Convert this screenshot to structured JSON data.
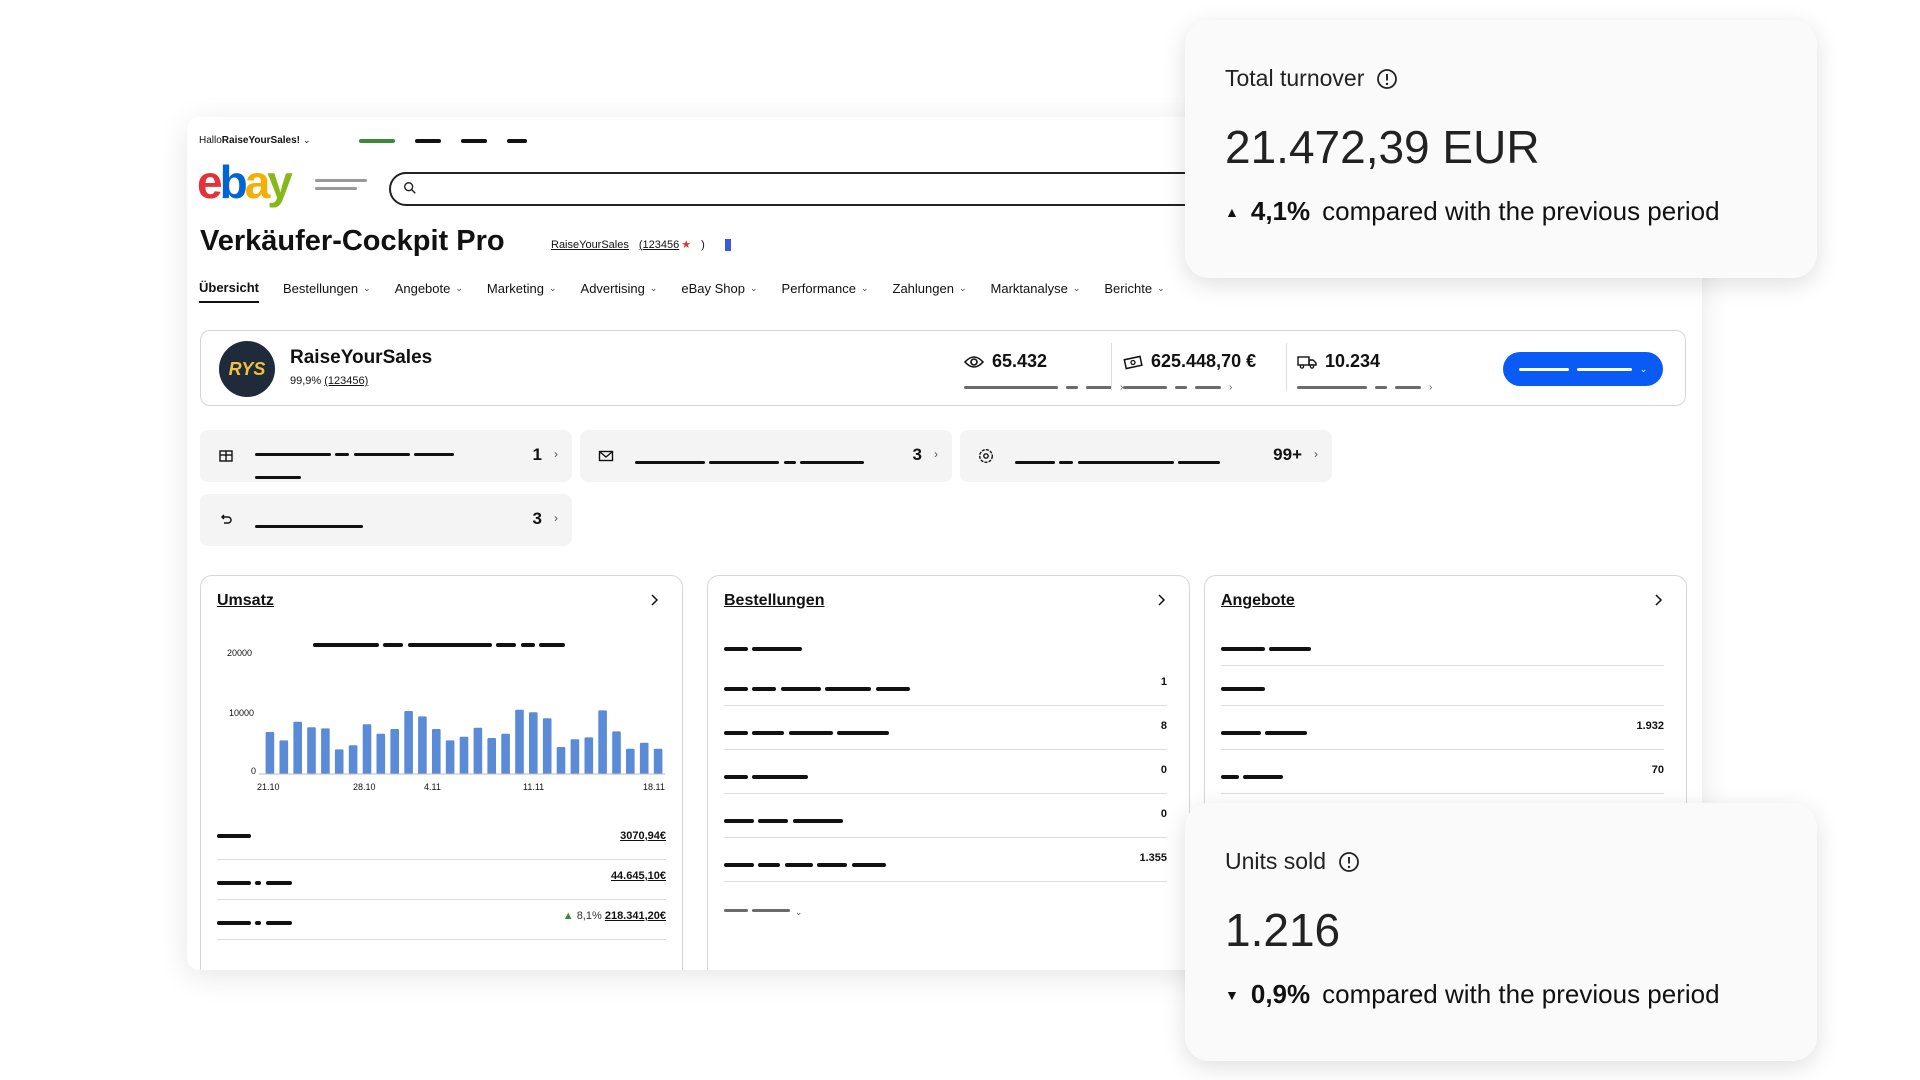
{
  "header": {
    "greeting_prefix": "Hallo ",
    "greeting_name": "RaiseYourSales!",
    "logo_letters": [
      "e",
      "b",
      "a",
      "y"
    ]
  },
  "page": {
    "title": "Verkäufer-Cockpit Pro",
    "seller_link": "RaiseYourSales",
    "seller_feedback": "(123456",
    "seller_feedback_close": ")"
  },
  "nav": {
    "tabs": [
      {
        "label": "Übersicht"
      },
      {
        "label": "Bestellungen"
      },
      {
        "label": "Angebote"
      },
      {
        "label": "Marketing"
      },
      {
        "label": "Advertising"
      },
      {
        "label": "eBay Shop"
      },
      {
        "label": "Performance"
      },
      {
        "label": "Zahlungen"
      },
      {
        "label": "Marktanalyse"
      },
      {
        "label": "Berichte"
      }
    ]
  },
  "seller": {
    "avatar_text": "RYS",
    "name": "RaiseYourSales",
    "rating": "99,9%",
    "rating_count": "(123456)",
    "views": "65.432",
    "sales": "625.448,70 €",
    "shipments": "10.234"
  },
  "tasks": [
    {
      "icon": "package-icon",
      "count": "1"
    },
    {
      "icon": "mail-icon",
      "count": "3"
    },
    {
      "icon": "settings-badge-icon",
      "count": "99+"
    },
    {
      "icon": "return-icon",
      "count": "3"
    }
  ],
  "umsatz": {
    "title": "Umsatz",
    "rows": [
      {
        "value": "3070,94€"
      },
      {
        "value": "44.645,10€"
      },
      {
        "delta": "8,1%",
        "value": "218.341,20€"
      }
    ]
  },
  "bestellungen": {
    "title": "Bestellungen",
    "rows": [
      {
        "value": "1"
      },
      {
        "value": "8"
      },
      {
        "value": "0"
      },
      {
        "value": "0"
      },
      {
        "value": "1.355"
      }
    ]
  },
  "angebote": {
    "title": "Angebote",
    "rows": [
      {
        "value": "1.932"
      },
      {
        "value": "70"
      }
    ]
  },
  "chart_data": {
    "type": "bar",
    "yticks": [
      "20000",
      "10000",
      "0"
    ],
    "ylim": [
      0,
      20000
    ],
    "xticks": [
      "21.10",
      "28.10",
      "4.11",
      "11.11",
      "18.11"
    ],
    "values": [
      7000,
      5600,
      8700,
      7800,
      7600,
      4100,
      4800,
      8300,
      6700,
      7500,
      10500,
      9600,
      7500,
      5600,
      6200,
      7700,
      6000,
      6700,
      10700,
      10300,
      9300,
      4500,
      5800,
      6100,
      10600,
      7100,
      4200,
      5200,
      4200
    ],
    "color": "#5b8bd6",
    "grid": false
  },
  "kpi_turnover": {
    "label": "Total turnover",
    "value": "21.472,39 EUR",
    "delta_pct": "4,1%",
    "delta_text": "compared with the previous period",
    "direction": "up"
  },
  "kpi_units": {
    "label": "Units sold",
    "value": "1.216",
    "delta_pct": "0,9%",
    "delta_text": "compared with the previous period",
    "direction": "down"
  }
}
